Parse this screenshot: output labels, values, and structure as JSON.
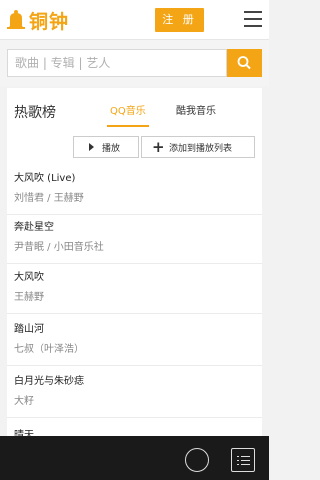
{
  "header": {
    "logo_text": "铜钟",
    "register_label": "注 册"
  },
  "search": {
    "placeholder": "歌曲 | 专辑 | 艺人"
  },
  "chart": {
    "title": "热歌榜",
    "tabs": [
      "QQ音乐",
      "酷我音乐"
    ],
    "active_tab": "QQ音乐",
    "play_label": "播放",
    "add_label": "添加到播放列表"
  },
  "songs": [
    {
      "title": "大风吹 (Live)",
      "artist": "刘惜君 / 王赫野"
    },
    {
      "title": "奔赴星空",
      "artist": "尹昔眠 / 小田音乐社"
    },
    {
      "title": "大风吹",
      "artist": "王赫野"
    },
    {
      "title": "踏山河",
      "artist": "七叔（叶泽浩）"
    },
    {
      "title": "白月光与朱砂痣",
      "artist": "大籽"
    },
    {
      "title": "晴天",
      "artist": ""
    }
  ],
  "colors": {
    "accent": "#f4a515",
    "footer_bg": "#1a1a1a"
  },
  "icons": [
    "bell-logo-icon",
    "menu-icon",
    "search-icon",
    "play-icon",
    "plus-icon",
    "circle-play-icon",
    "playlist-icon"
  ]
}
